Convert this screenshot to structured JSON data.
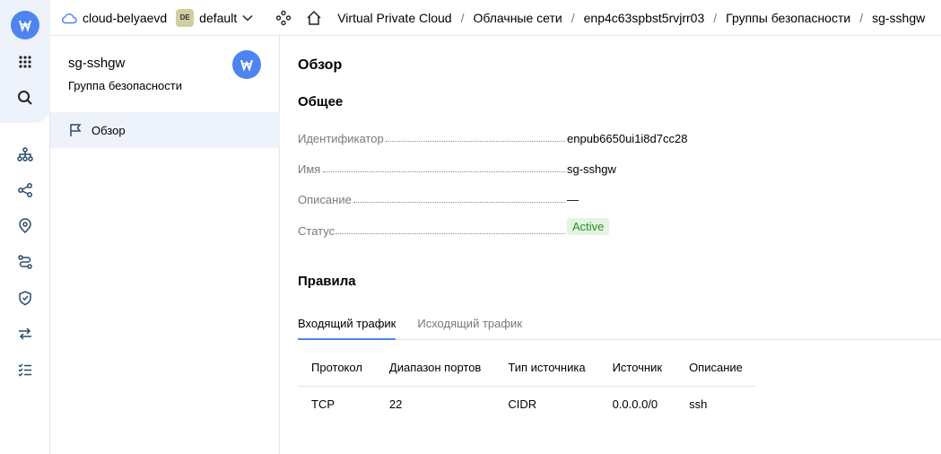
{
  "topbar": {
    "cloud_name": "cloud-belyaevd",
    "folder_badge": "DE",
    "folder_name": "default",
    "breadcrumbs": [
      "Virtual Private Cloud",
      "Облачные сети",
      "enp4c63spbst5rvjrr03",
      "Группы безопасности",
      "sg-sshgw"
    ],
    "separator": "/"
  },
  "sidebar": {
    "title": "sg-sshgw",
    "subtitle": "Группа безопасности",
    "items": [
      {
        "label": "Обзор",
        "icon": "flag-icon"
      }
    ]
  },
  "main": {
    "heading": "Обзор",
    "general_heading": "Общее",
    "properties": [
      {
        "key": "Идентификатор",
        "value": "enpub6650ui1i8d7cc28"
      },
      {
        "key": "Имя",
        "value": "sg-sshgw"
      },
      {
        "key": "Описание",
        "value": "—"
      },
      {
        "key": "Статус",
        "value": "Active"
      }
    ],
    "rules_heading": "Правила",
    "tabs": [
      "Входящий трафик",
      "Исходящий трафик"
    ],
    "active_tab": 0,
    "table": {
      "columns": [
        "Протокол",
        "Диапазон портов",
        "Тип источника",
        "Источник",
        "Описание"
      ],
      "rows": [
        [
          "TCP",
          "22",
          "CIDR",
          "0.0.0.0/0",
          "ssh"
        ]
      ]
    }
  },
  "colors": {
    "accent": "#4d84f0",
    "status_active_bg": "#e3f5e1",
    "status_active_text": "#2e8a2a"
  }
}
